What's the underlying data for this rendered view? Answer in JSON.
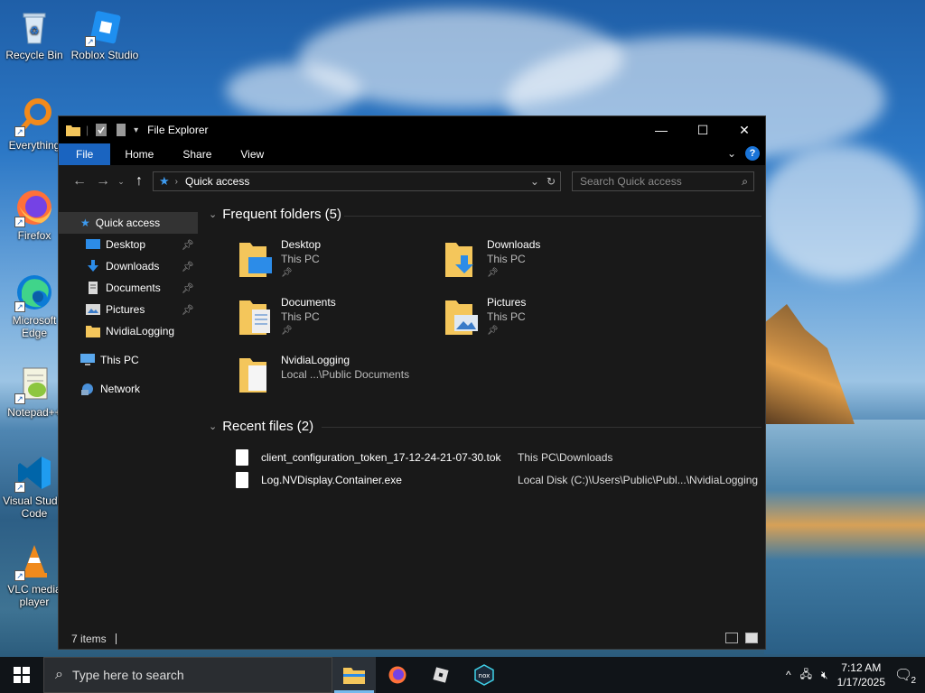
{
  "desktop": {
    "icons": [
      {
        "label": "Recycle Bin"
      },
      {
        "label": "Roblox Studio"
      },
      {
        "label": "Everything"
      },
      {
        "label": "Firefox"
      },
      {
        "label": "Microsoft Edge"
      },
      {
        "label": "Notepad++"
      },
      {
        "label": "Visual Studio Code"
      },
      {
        "label": "VLC media player"
      }
    ]
  },
  "window": {
    "title": "File Explorer",
    "ribbon_tabs": [
      "File",
      "Home",
      "Share",
      "View"
    ],
    "address": "Quick access",
    "search_placeholder": "Search Quick access",
    "sidebar": {
      "quick_access": "Quick access",
      "items": [
        {
          "label": "Desktop",
          "pinned": true
        },
        {
          "label": "Downloads",
          "pinned": true
        },
        {
          "label": "Documents",
          "pinned": true
        },
        {
          "label": "Pictures",
          "pinned": true
        },
        {
          "label": "NvidiaLogging",
          "pinned": false
        }
      ],
      "this_pc": "This PC",
      "network": "Network"
    },
    "frequent": {
      "heading": "Frequent folders (5)",
      "folders": [
        {
          "name": "Desktop",
          "location": "This PC"
        },
        {
          "name": "Downloads",
          "location": "This PC"
        },
        {
          "name": "Documents",
          "location": "This PC"
        },
        {
          "name": "Pictures",
          "location": "This PC"
        },
        {
          "name": "NvidiaLogging",
          "location": "Local ...\\Public Documents"
        }
      ]
    },
    "recent": {
      "heading": "Recent files (2)",
      "files": [
        {
          "name": "client_configuration_token_17-12-24-21-07-30.tok",
          "location": "This PC\\Downloads"
        },
        {
          "name": "Log.NVDisplay.Container.exe",
          "location": "Local Disk (C:)\\Users\\Public\\Publ...\\NvidiaLogging"
        }
      ]
    },
    "status": "7 items"
  },
  "taskbar": {
    "search_placeholder": "Type here to search",
    "time": "7:12 AM",
    "date": "1/17/2025",
    "notification_count": "2"
  }
}
